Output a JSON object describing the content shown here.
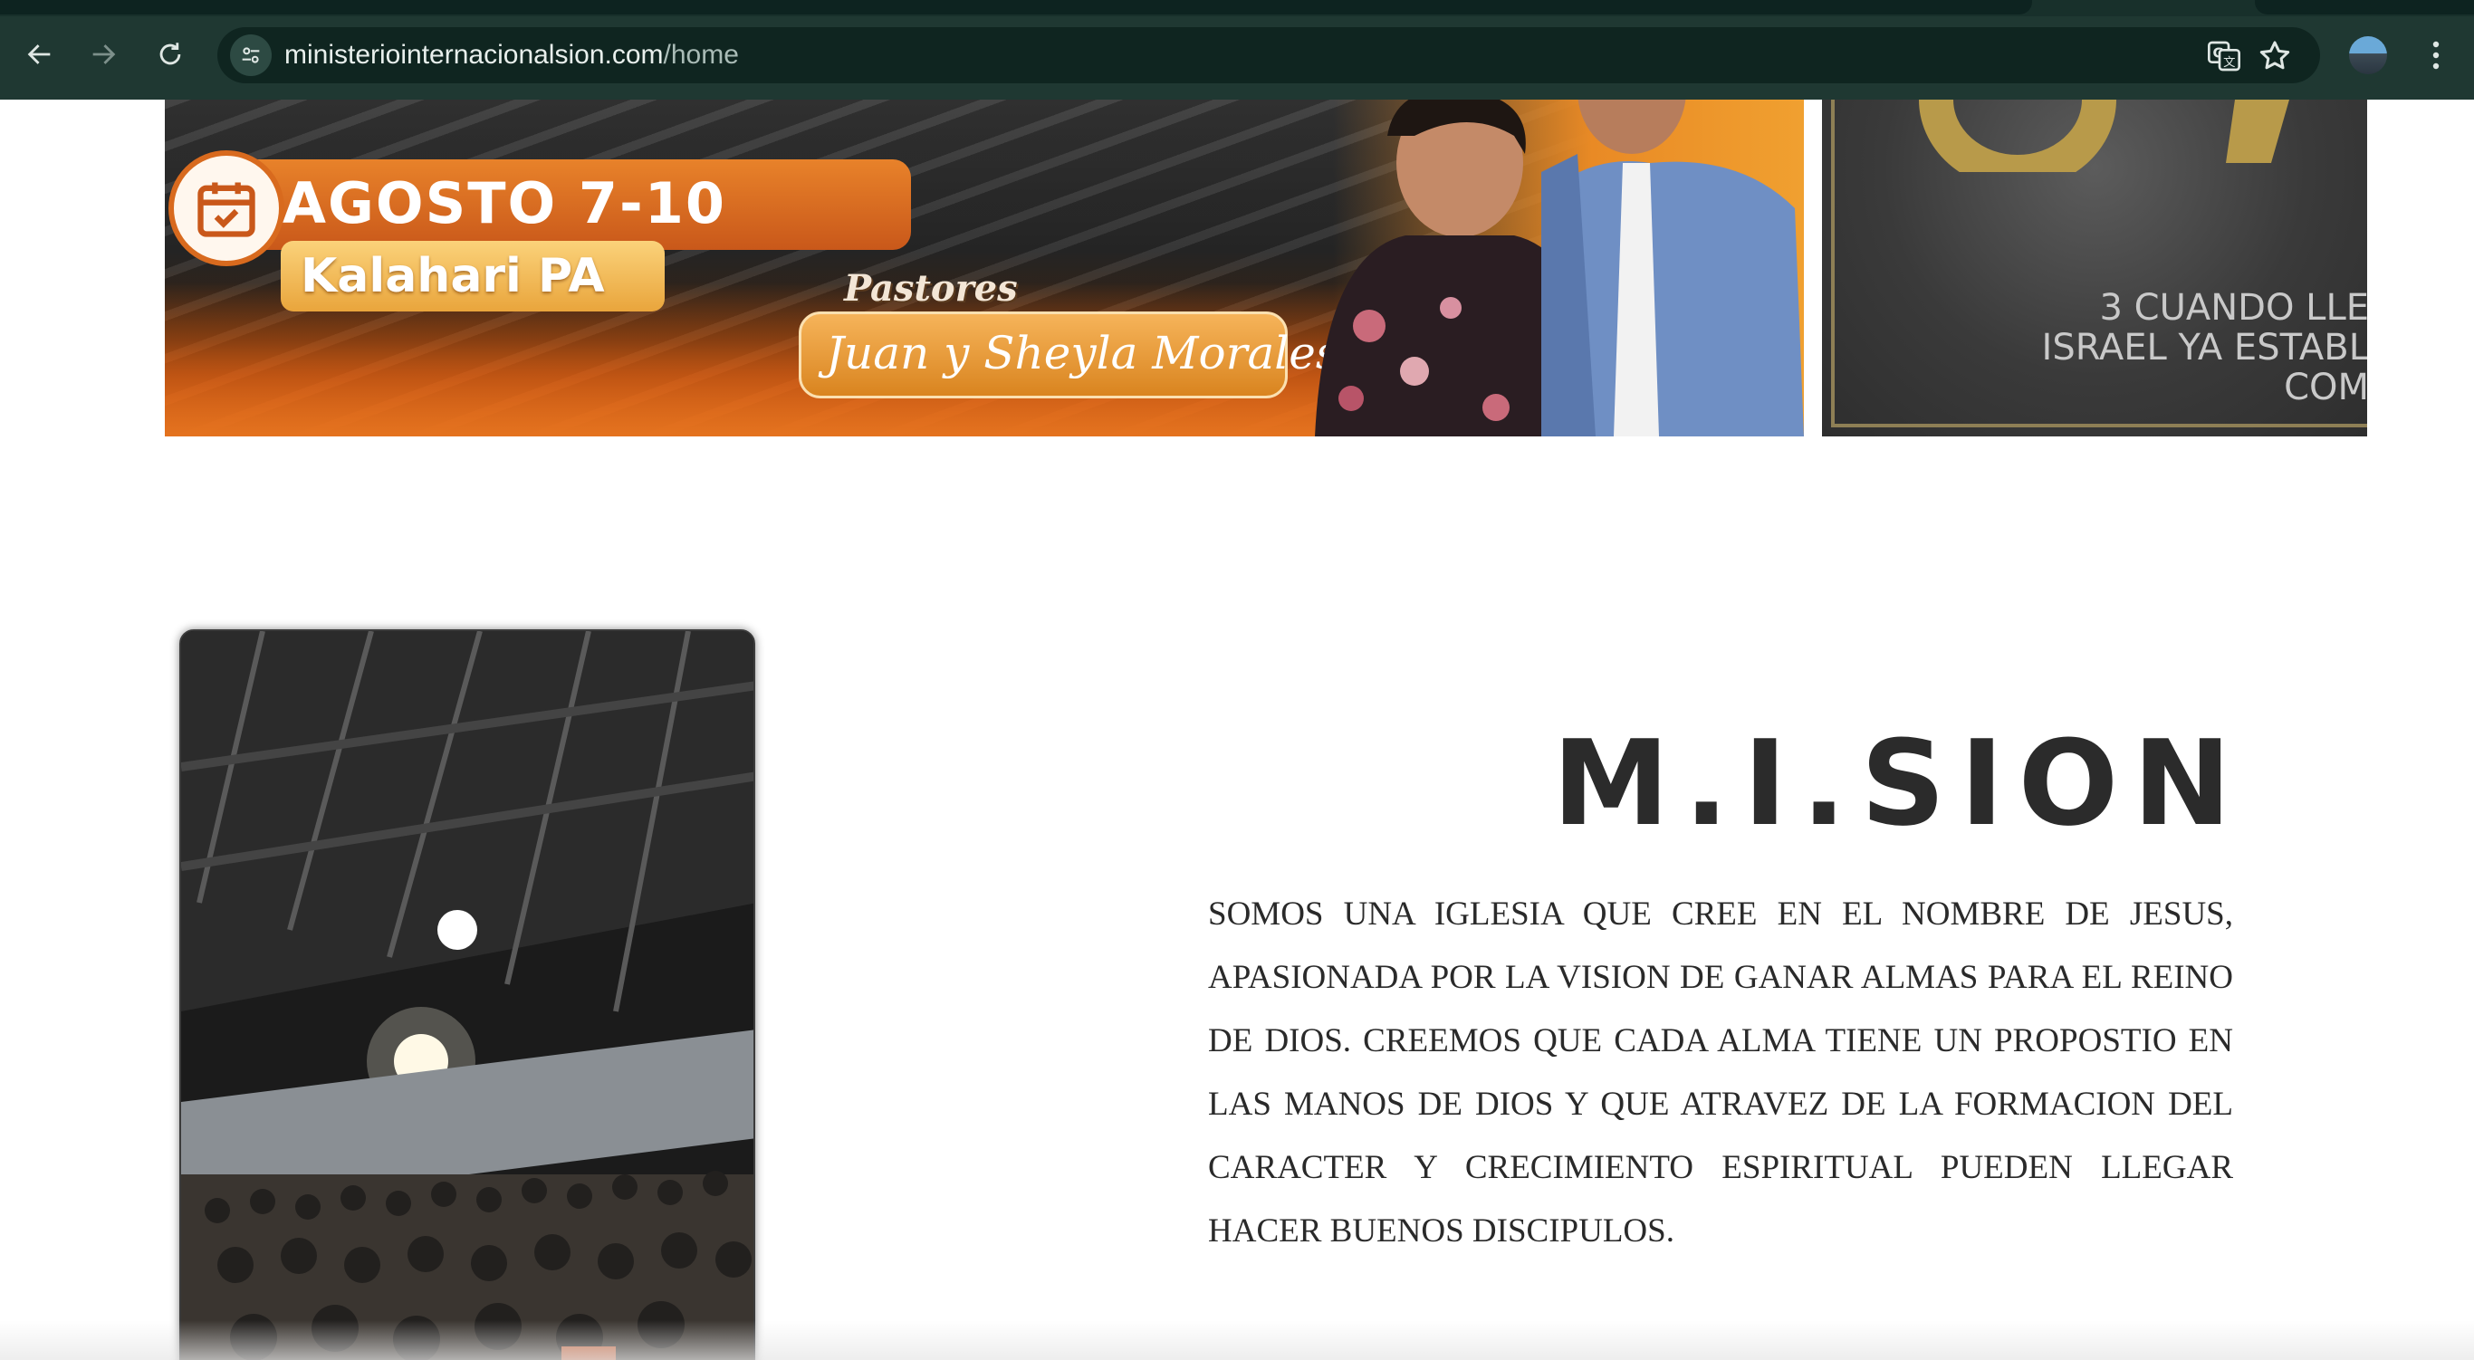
{
  "browser": {
    "url_domain": "ministeriointernacionalsion.com",
    "url_path": "/home",
    "icons": {
      "back": "arrow-left-icon",
      "forward": "arrow-right-icon",
      "reload": "reload-icon",
      "site_info": "tune-icon",
      "translate": "translate-icon",
      "bookmark": "star-icon",
      "profile": "avatar",
      "menu": "kebab-menu-icon"
    }
  },
  "banner": {
    "date": "AGOSTO 7-10",
    "location": "Kalahari PA",
    "pastores_label": "Pastores",
    "pastores_names": "Juan y Sheyla Morales",
    "side_verse": "3 CUANDO LLE\nISRAEL YA ESTABL\nCOM"
  },
  "mission": {
    "title": "M.I.SION",
    "body": "SOMOS UNA IGLESIA QUE CREE EN EL NOMBRE DE JESUS, APASIONADA POR LA VISION DE GANAR ALMAS PARA EL REINO DE DIOS. CREEMOS QUE CADA ALMA TIENE UN PROPOSTIO EN LAS MANOS DE DIOS Y QUE ATRAVEZ DE LA FORMACION DEL CARACTER Y CRECIMIENTO ESPIRITUAL PUEDEN LLEGAR HACER BUENOS DISCIPULOS."
  },
  "colors": {
    "chrome_bg": "#1f3832",
    "urlbar_bg": "#0f2520",
    "accent_orange": "#e4731f",
    "title_text": "#2b2b2b"
  }
}
